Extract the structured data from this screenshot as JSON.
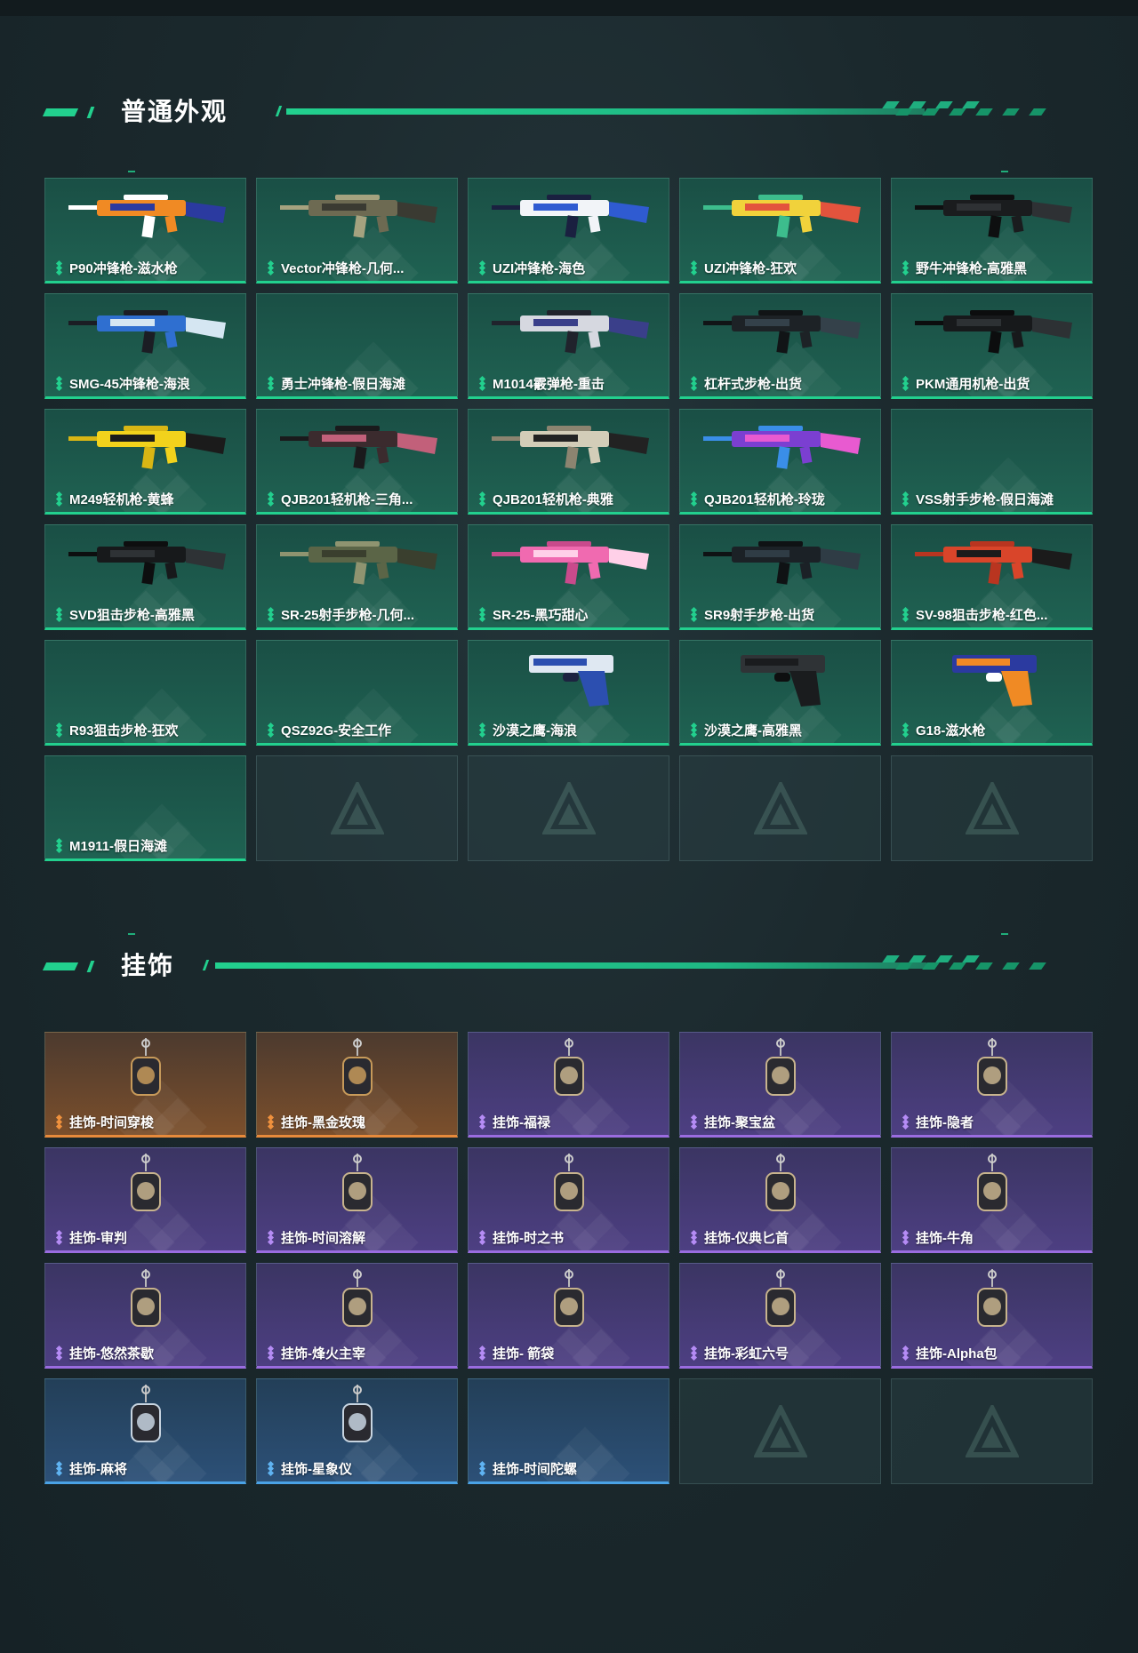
{
  "sections": {
    "skins": {
      "title": "普通外观",
      "items": [
        {
          "label": "P90冲锋枪-滋水枪",
          "rarity": "green",
          "icon": "p90-smg-icon",
          "colors": [
            "#f08a24",
            "#2b3aa0",
            "#ffffff"
          ]
        },
        {
          "label": "Vector冲锋枪-几何...",
          "rarity": "green",
          "icon": "vector-smg-icon",
          "colors": [
            "#6d6a52",
            "#3a3a32",
            "#a5a27f"
          ]
        },
        {
          "label": "UZI冲锋枪-海色",
          "rarity": "green",
          "icon": "uzi-smg-icon",
          "colors": [
            "#f2f4f8",
            "#2f5bd1",
            "#1a2040"
          ]
        },
        {
          "label": "UZI冲锋枪-狂欢",
          "rarity": "green",
          "icon": "uzi-smg-icon",
          "colors": [
            "#f1d23b",
            "#e3533d",
            "#3dbd8d"
          ]
        },
        {
          "label": "野牛冲锋枪-高雅黑",
          "rarity": "green",
          "icon": "bizon-smg-icon",
          "colors": [
            "#1a1c1e",
            "#2e3134",
            "#0e0f10"
          ]
        },
        {
          "label": "SMG-45冲锋枪-海浪",
          "rarity": "green",
          "icon": "smg45-icon",
          "colors": [
            "#2f6fd0",
            "#d5e6f2",
            "#1b1d24"
          ]
        },
        {
          "label": "勇士冲锋枪-假日海滩",
          "rarity": "green",
          "icon": "",
          "colors": []
        },
        {
          "label": "M1014霰弹枪-重击",
          "rarity": "green",
          "icon": "m1014-shotgun-icon",
          "colors": [
            "#d6d8e0",
            "#3a3f8a",
            "#20232c"
          ]
        },
        {
          "label": "杠杆式步枪-出货",
          "rarity": "green",
          "icon": "lever-rifle-icon",
          "colors": [
            "#1d2226",
            "#34414a",
            "#111416"
          ]
        },
        {
          "label": "PKM通用机枪-出货",
          "rarity": "green",
          "icon": "pkm-lmg-icon",
          "colors": [
            "#17191b",
            "#2d3134",
            "#0c0d0e"
          ]
        },
        {
          "label": "M249轻机枪-黄蜂",
          "rarity": "green",
          "icon": "m249-lmg-icon",
          "colors": [
            "#f2d21c",
            "#1b1b1b",
            "#d9b614"
          ]
        },
        {
          "label": "QJB201轻机枪-三角...",
          "rarity": "green",
          "icon": "qjb201-lmg-icon",
          "colors": [
            "#3b2b2e",
            "#c2607a",
            "#1a1a1c"
          ]
        },
        {
          "label": "QJB201轻机枪-典雅",
          "rarity": "green",
          "icon": "qjb201-lmg-icon",
          "colors": [
            "#d3cdb8",
            "#222222",
            "#8c8470"
          ]
        },
        {
          "label": "QJB201轻机枪-玲珑",
          "rarity": "green",
          "icon": "qjb201-lmg-icon",
          "colors": [
            "#7b3fd1",
            "#e85ad0",
            "#3a8ee8"
          ]
        },
        {
          "label": "VSS射手步枪-假日海滩",
          "rarity": "green",
          "icon": "",
          "colors": []
        },
        {
          "label": "SVD狙击步枪-高雅黑",
          "rarity": "green",
          "icon": "svd-sniper-icon",
          "colors": [
            "#17191b",
            "#2e3235",
            "#0d0e0f"
          ]
        },
        {
          "label": "SR-25射手步枪-几何...",
          "rarity": "green",
          "icon": "sr25-rifle-icon",
          "colors": [
            "#5b6547",
            "#3a3f2e",
            "#8f9470"
          ]
        },
        {
          "label": "SR-25-黑巧甜心",
          "rarity": "green",
          "icon": "sr25-rifle-icon",
          "colors": [
            "#f06ab0",
            "#ffd0e8",
            "#c94a8c"
          ]
        },
        {
          "label": "SR9射手步枪-出货",
          "rarity": "green",
          "icon": "sr9-rifle-icon",
          "colors": [
            "#1b2126",
            "#2f3c45",
            "#0f1214"
          ]
        },
        {
          "label": "SV-98狙击步枪-红色...",
          "rarity": "green",
          "icon": "sv98-sniper-icon",
          "colors": [
            "#d9452a",
            "#1b1b1b",
            "#b93520"
          ]
        },
        {
          "label": "R93狙击步枪-狂欢",
          "rarity": "green",
          "icon": "",
          "colors": []
        },
        {
          "label": "QSZ92G-安全工作",
          "rarity": "green",
          "icon": "",
          "colors": []
        },
        {
          "label": "沙漠之鹰-海浪",
          "rarity": "green",
          "icon": "desert-eagle-icon",
          "colors": [
            "#2c4fb0",
            "#dfe8f2",
            "#1c2340"
          ]
        },
        {
          "label": "沙漠之鹰-高雅黑",
          "rarity": "green",
          "icon": "desert-eagle-icon",
          "colors": [
            "#1a1c1e",
            "#2f3336",
            "#0e0f10"
          ]
        },
        {
          "label": "G18-滋水枪",
          "rarity": "green",
          "icon": "g18-pistol-icon",
          "colors": [
            "#f08a24",
            "#2b3aa0",
            "#ffffff"
          ]
        },
        {
          "label": "M1911-假日海滩",
          "rarity": "green",
          "icon": "",
          "colors": []
        }
      ],
      "empty_slots": 4
    },
    "charms": {
      "title": "挂饰",
      "items": [
        {
          "label": "挂饰-时间穿梭",
          "rarity": "orange",
          "icon": "time-shuttle-charm-icon"
        },
        {
          "label": "挂饰-黑金玫瑰",
          "rarity": "orange",
          "icon": "black-gold-rose-charm-icon"
        },
        {
          "label": "挂饰-福禄",
          "rarity": "purple",
          "icon": "gourd-charm-icon"
        },
        {
          "label": "挂饰-聚宝盆",
          "rarity": "purple",
          "icon": "treasure-bowl-charm-icon"
        },
        {
          "label": "挂饰-隐者",
          "rarity": "purple",
          "icon": "hermit-card-charm-icon"
        },
        {
          "label": "挂饰-审判",
          "rarity": "purple",
          "icon": "judgement-card-charm-icon"
        },
        {
          "label": "挂饰-时间溶解",
          "rarity": "purple",
          "icon": "melting-clock-charm-icon"
        },
        {
          "label": "挂饰-时之书",
          "rarity": "purple",
          "icon": "book-charm-icon"
        },
        {
          "label": "挂饰-仪典匕首",
          "rarity": "purple",
          "icon": "dagger-charm-icon"
        },
        {
          "label": "挂饰-牛角",
          "rarity": "purple",
          "icon": "horns-charm-icon"
        },
        {
          "label": "挂饰-悠然茶歇",
          "rarity": "purple",
          "icon": "cupcake-charm-icon"
        },
        {
          "label": "挂饰-烽火主宰",
          "rarity": "purple",
          "icon": "crate-charm-icon"
        },
        {
          "label": "挂饰- 箭袋",
          "rarity": "purple",
          "icon": "quiver-charm-icon"
        },
        {
          "label": "挂饰-彩虹六号",
          "rarity": "purple",
          "icon": "rainbow-six-charm-icon"
        },
        {
          "label": "挂饰-Alpha包",
          "rarity": "purple",
          "icon": "alpha-bag-charm-icon"
        },
        {
          "label": "挂饰-麻将",
          "rarity": "blue",
          "icon": "mahjong-charm-icon"
        },
        {
          "label": "挂饰-星象仪",
          "rarity": "blue",
          "icon": "astrolabe-charm-icon"
        },
        {
          "label": "挂饰-时间陀螺",
          "rarity": "blue",
          "icon": ""
        }
      ],
      "empty_slots": 2
    }
  },
  "colors": {
    "accent": "#22d08e",
    "orange": "#e78a3b",
    "purple": "#9a6ce0",
    "blue": "#4aa2e6"
  }
}
